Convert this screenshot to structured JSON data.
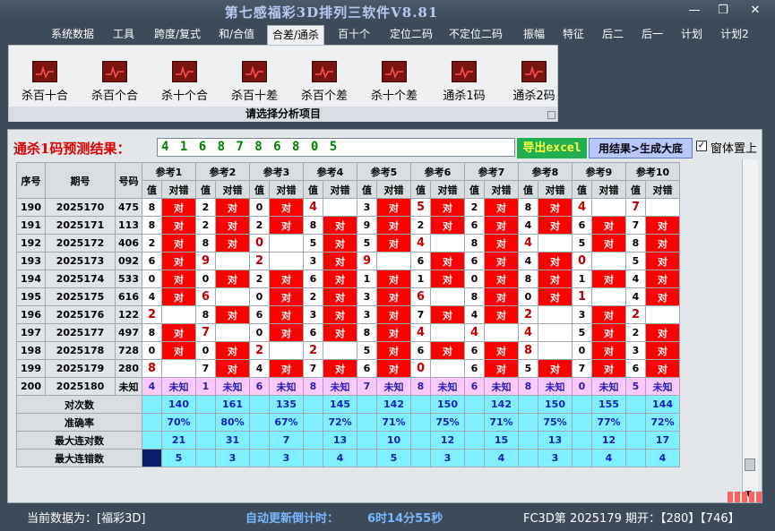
{
  "app_title": "第七感福彩3D排列三软件V8.81",
  "window_controls": {
    "minimize": "—",
    "restore": "❐",
    "close": "✕"
  },
  "menu": [
    "系统数据",
    "工具",
    "跨度/复式",
    "和/合值",
    "合差/通杀",
    "百十个",
    "定位二码",
    "不定位二码",
    "振幅",
    "特征",
    "后二",
    "后一",
    "计划",
    "计划2"
  ],
  "menu_active": 4,
  "ribbon": {
    "items": [
      "杀百十合",
      "杀百个合",
      "杀十个合",
      "杀百十差",
      "杀百个差",
      "杀十个差",
      "通杀1码",
      "通杀2码"
    ],
    "hint": "请选择分析项目"
  },
  "prediction": {
    "label": "通杀1码预测结果：",
    "value": "4 1 6 8 7 8 6 8 0 5",
    "export_label": "导出excel",
    "generate_label": "用结果>生成大底",
    "pin_label": "窗体置上",
    "pin_checked": "✓"
  },
  "table": {
    "headers": {
      "seq": "序号",
      "issue": "期号",
      "code": "号码",
      "value": "值",
      "result": "对错"
    },
    "refs": [
      "参考1",
      "参考2",
      "参考3",
      "参考4",
      "参考5",
      "参考6",
      "参考7",
      "参考8",
      "参考9",
      "参考10"
    ],
    "hit_text": "对",
    "unknown_text": "未知",
    "rows": [
      {
        "seq": "190",
        "issue": "2025170",
        "code": "475",
        "vals": [
          "8",
          "2",
          "0",
          "4",
          "3",
          "5",
          "2",
          "8",
          "4",
          "7"
        ],
        "hits": [
          1,
          1,
          1,
          0,
          1,
          1,
          1,
          1,
          0,
          0
        ],
        "big": [
          0,
          0,
          0,
          1,
          0,
          1,
          0,
          0,
          1,
          1
        ]
      },
      {
        "seq": "191",
        "issue": "2025171",
        "code": "113",
        "vals": [
          "8",
          "2",
          "2",
          "8",
          "9",
          "2",
          "6",
          "4",
          "6",
          "7"
        ],
        "hits": [
          1,
          1,
          1,
          1,
          1,
          1,
          1,
          1,
          1,
          1
        ],
        "big": [
          0,
          0,
          0,
          0,
          0,
          0,
          0,
          0,
          0,
          0
        ]
      },
      {
        "seq": "192",
        "issue": "2025172",
        "code": "406",
        "vals": [
          "2",
          "8",
          "0",
          "5",
          "5",
          "4",
          "8",
          "4",
          "5",
          "8"
        ],
        "hits": [
          1,
          1,
          0,
          1,
          1,
          0,
          1,
          0,
          1,
          1
        ],
        "big": [
          0,
          0,
          1,
          0,
          0,
          1,
          0,
          1,
          0,
          0
        ]
      },
      {
        "seq": "193",
        "issue": "2025173",
        "code": "092",
        "vals": [
          "6",
          "9",
          "2",
          "3",
          "9",
          "6",
          "6",
          "4",
          "0",
          "5"
        ],
        "hits": [
          1,
          0,
          0,
          1,
          0,
          1,
          1,
          1,
          0,
          1
        ],
        "big": [
          0,
          1,
          1,
          0,
          1,
          0,
          0,
          0,
          1,
          0
        ]
      },
      {
        "seq": "194",
        "issue": "2025174",
        "code": "533",
        "vals": [
          "0",
          "0",
          "2",
          "6",
          "1",
          "1",
          "0",
          "8",
          "1",
          "4"
        ],
        "hits": [
          1,
          1,
          1,
          1,
          1,
          1,
          1,
          1,
          1,
          1
        ],
        "big": [
          0,
          0,
          0,
          0,
          0,
          0,
          0,
          0,
          0,
          0
        ]
      },
      {
        "seq": "195",
        "issue": "2025175",
        "code": "616",
        "vals": [
          "4",
          "6",
          "0",
          "2",
          "3",
          "6",
          "8",
          "0",
          "1",
          "4"
        ],
        "hits": [
          1,
          0,
          1,
          1,
          1,
          0,
          1,
          1,
          0,
          1
        ],
        "big": [
          0,
          1,
          0,
          0,
          0,
          1,
          0,
          0,
          1,
          0
        ]
      },
      {
        "seq": "196",
        "issue": "2025176",
        "code": "122",
        "vals": [
          "2",
          "8",
          "6",
          "3",
          "3",
          "7",
          "4",
          "2",
          "3",
          "2"
        ],
        "hits": [
          0,
          1,
          1,
          1,
          1,
          1,
          1,
          0,
          1,
          0
        ],
        "big": [
          1,
          0,
          0,
          0,
          0,
          0,
          0,
          1,
          0,
          1
        ]
      },
      {
        "seq": "197",
        "issue": "2025177",
        "code": "497",
        "vals": [
          "8",
          "7",
          "0",
          "6",
          "8",
          "4",
          "4",
          "4",
          "5",
          "2"
        ],
        "hits": [
          1,
          0,
          1,
          1,
          1,
          0,
          0,
          0,
          1,
          1
        ],
        "big": [
          0,
          1,
          0,
          0,
          0,
          1,
          1,
          1,
          0,
          0
        ]
      },
      {
        "seq": "198",
        "issue": "2025178",
        "code": "728",
        "vals": [
          "0",
          "0",
          "2",
          "2",
          "5",
          "6",
          "6",
          "8",
          "0",
          "3"
        ],
        "hits": [
          1,
          1,
          0,
          0,
          1,
          1,
          1,
          0,
          1,
          1
        ],
        "big": [
          0,
          0,
          1,
          1,
          0,
          0,
          0,
          1,
          0,
          0
        ]
      },
      {
        "seq": "199",
        "issue": "2025179",
        "code": "280",
        "vals": [
          "8",
          "7",
          "4",
          "7",
          "6",
          "0",
          "6",
          "5",
          "7",
          "6"
        ],
        "hits": [
          0,
          1,
          1,
          1,
          1,
          0,
          1,
          1,
          1,
          1
        ],
        "big": [
          1,
          0,
          0,
          0,
          0,
          1,
          0,
          0,
          0,
          0
        ]
      }
    ],
    "pending": {
      "seq": "200",
      "issue": "2025180",
      "code": "未知",
      "vals": [
        "4",
        "1",
        "6",
        "8",
        "7",
        "8",
        "6",
        "8",
        "0",
        "5"
      ]
    },
    "stats": [
      {
        "label": "对次数",
        "values": [
          "140",
          "161",
          "135",
          "145",
          "142",
          "150",
          "142",
          "150",
          "155",
          "144"
        ]
      },
      {
        "label": "准确率",
        "values": [
          "70%",
          "80%",
          "67%",
          "72%",
          "71%",
          "75%",
          "71%",
          "75%",
          "77%",
          "72%"
        ]
      },
      {
        "label": "最大连对数",
        "values": [
          "21",
          "31",
          "7",
          "13",
          "10",
          "12",
          "15",
          "13",
          "12",
          "17"
        ]
      },
      {
        "label": "最大连错数",
        "values": [
          "5",
          "3",
          "3",
          "4",
          "5",
          "3",
          "4",
          "3",
          "4",
          "4"
        ]
      }
    ]
  },
  "status": {
    "current_data": "当前数据为：[福彩3D]",
    "countdown_label": "自动更新倒计时：",
    "countdown_value": "6时14分55秒",
    "draw_info": "FC3D第 2025179 期开：【280】【746】"
  },
  "colors": {
    "hit": "#ff0000",
    "unknown": "#ffc8ff",
    "stat": "#7ff0ff",
    "title": "#b8c8f0"
  }
}
